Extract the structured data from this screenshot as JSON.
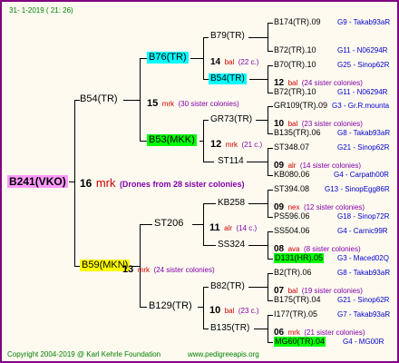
{
  "header": {
    "date": "31-   1-2019  (  21:  26)"
  },
  "footer": {
    "copyright": "Copyright 2004-2019 @ Karl Kehrle Foundation",
    "site": "www.pedigreeapis.org"
  },
  "colors": {
    "border": "#800080",
    "group_text": "#0000cc",
    "mrk": "#cc0000",
    "sister": "#8000aa",
    "highlight_magenta": "#ff99ff",
    "highlight_yellow": "#ffff00",
    "highlight_cyan": "#00ffff",
    "highlight_green": "#00ff00"
  },
  "root": {
    "name": "B241(VKO)",
    "count": "16",
    "mark": "mrk",
    "drones": "(Drones from 28 sister colonies)"
  },
  "gen1": {
    "upper": {
      "name": "B54(TR)",
      "count": "15",
      "mark": "mrk",
      "sisters": "(30 sister colonies)"
    },
    "lower": {
      "name": "B59(MKN)",
      "count": "13",
      "mark": "mrk",
      "sisters": "(24 sister colonies)"
    }
  },
  "gen2": {
    "b76": {
      "name": "B76(TR)"
    },
    "b53": {
      "name": "B53(MKK)",
      "count": "12",
      "mark": "mrk",
      "sisters": "(21 c.)"
    },
    "st206": {
      "name": "ST206",
      "count": "11",
      "mark": "alr",
      "sisters": "(14 c.)"
    },
    "b129": {
      "name": "B129(TR)",
      "count": "10",
      "mark": "bal",
      "sisters": "(23 c.)"
    }
  },
  "gen3": {
    "b79": {
      "name": "B79(TR)",
      "count": "14",
      "mark": "bal",
      "sisters": "(22 c.)"
    },
    "b54b": {
      "name": "B54(TR)",
      "count": "12",
      "mark": "bal",
      "sisters": "(24 sister colonies)"
    },
    "gr73": {
      "name": "GR73(TR)",
      "count": "10",
      "mark": "bal",
      "sisters": "(23 sister colonies)"
    },
    "st114": {
      "name": "ST114",
      "count": "09",
      "mark": "alr",
      "sisters": "(14 sister colonies)"
    },
    "kb258": {
      "name": "KB258",
      "count": "09",
      "mark": "nex",
      "sisters": "(12 sister colonies)"
    },
    "ss324": {
      "name": "SS324",
      "count": "08",
      "mark": "ava",
      "sisters": "(8 sister colonies)"
    },
    "b82": {
      "name": "B82(TR)",
      "count": "07",
      "mark": "bal",
      "sisters": "(19 sister colonies)"
    },
    "b135": {
      "name": "B135(TR)",
      "count": "06",
      "mark": "mrk",
      "sisters": "(21 sister colonies)"
    }
  },
  "gen4": [
    {
      "name": "B174(TR).09",
      "group": "G9 - Takab93aR"
    },
    {
      "name": "B72(TR).10",
      "group": "G11 - N06294R"
    },
    {
      "name": "B70(TR).10",
      "group": "G25 - Sinop62R"
    },
    {
      "name": "B72(TR).10",
      "group": "G11 - N06294R"
    },
    {
      "name": "GR109(TR).09",
      "group": "G3 - Gr.R.mounta"
    },
    {
      "name": "B135(TR).06",
      "group": "G8 - Takab93aR"
    },
    {
      "name": "ST348.07",
      "group": "G21 - Sinop62R"
    },
    {
      "name": "KB080.06",
      "group": "G4 - Carpath00R"
    },
    {
      "name": "ST394.08",
      "group": "G13 - SinopEgg86R"
    },
    {
      "name": "PS596.06",
      "group": "G18 - Sinop72R"
    },
    {
      "name": "SS504.06",
      "group": "G4 - Carnic99R"
    },
    {
      "name": "D131(HR).05",
      "group": "G3 - Maced02Q"
    },
    {
      "name": "B2(TR).06",
      "group": "G8 - Takab93aR"
    },
    {
      "name": "B175(TR).04",
      "group": "G21 - Sinop62R"
    },
    {
      "name": "I177(TR).05",
      "group": "G7 - Takab93aR"
    },
    {
      "name": "MG60(TR).04",
      "group": "G4 - MG00R"
    }
  ]
}
